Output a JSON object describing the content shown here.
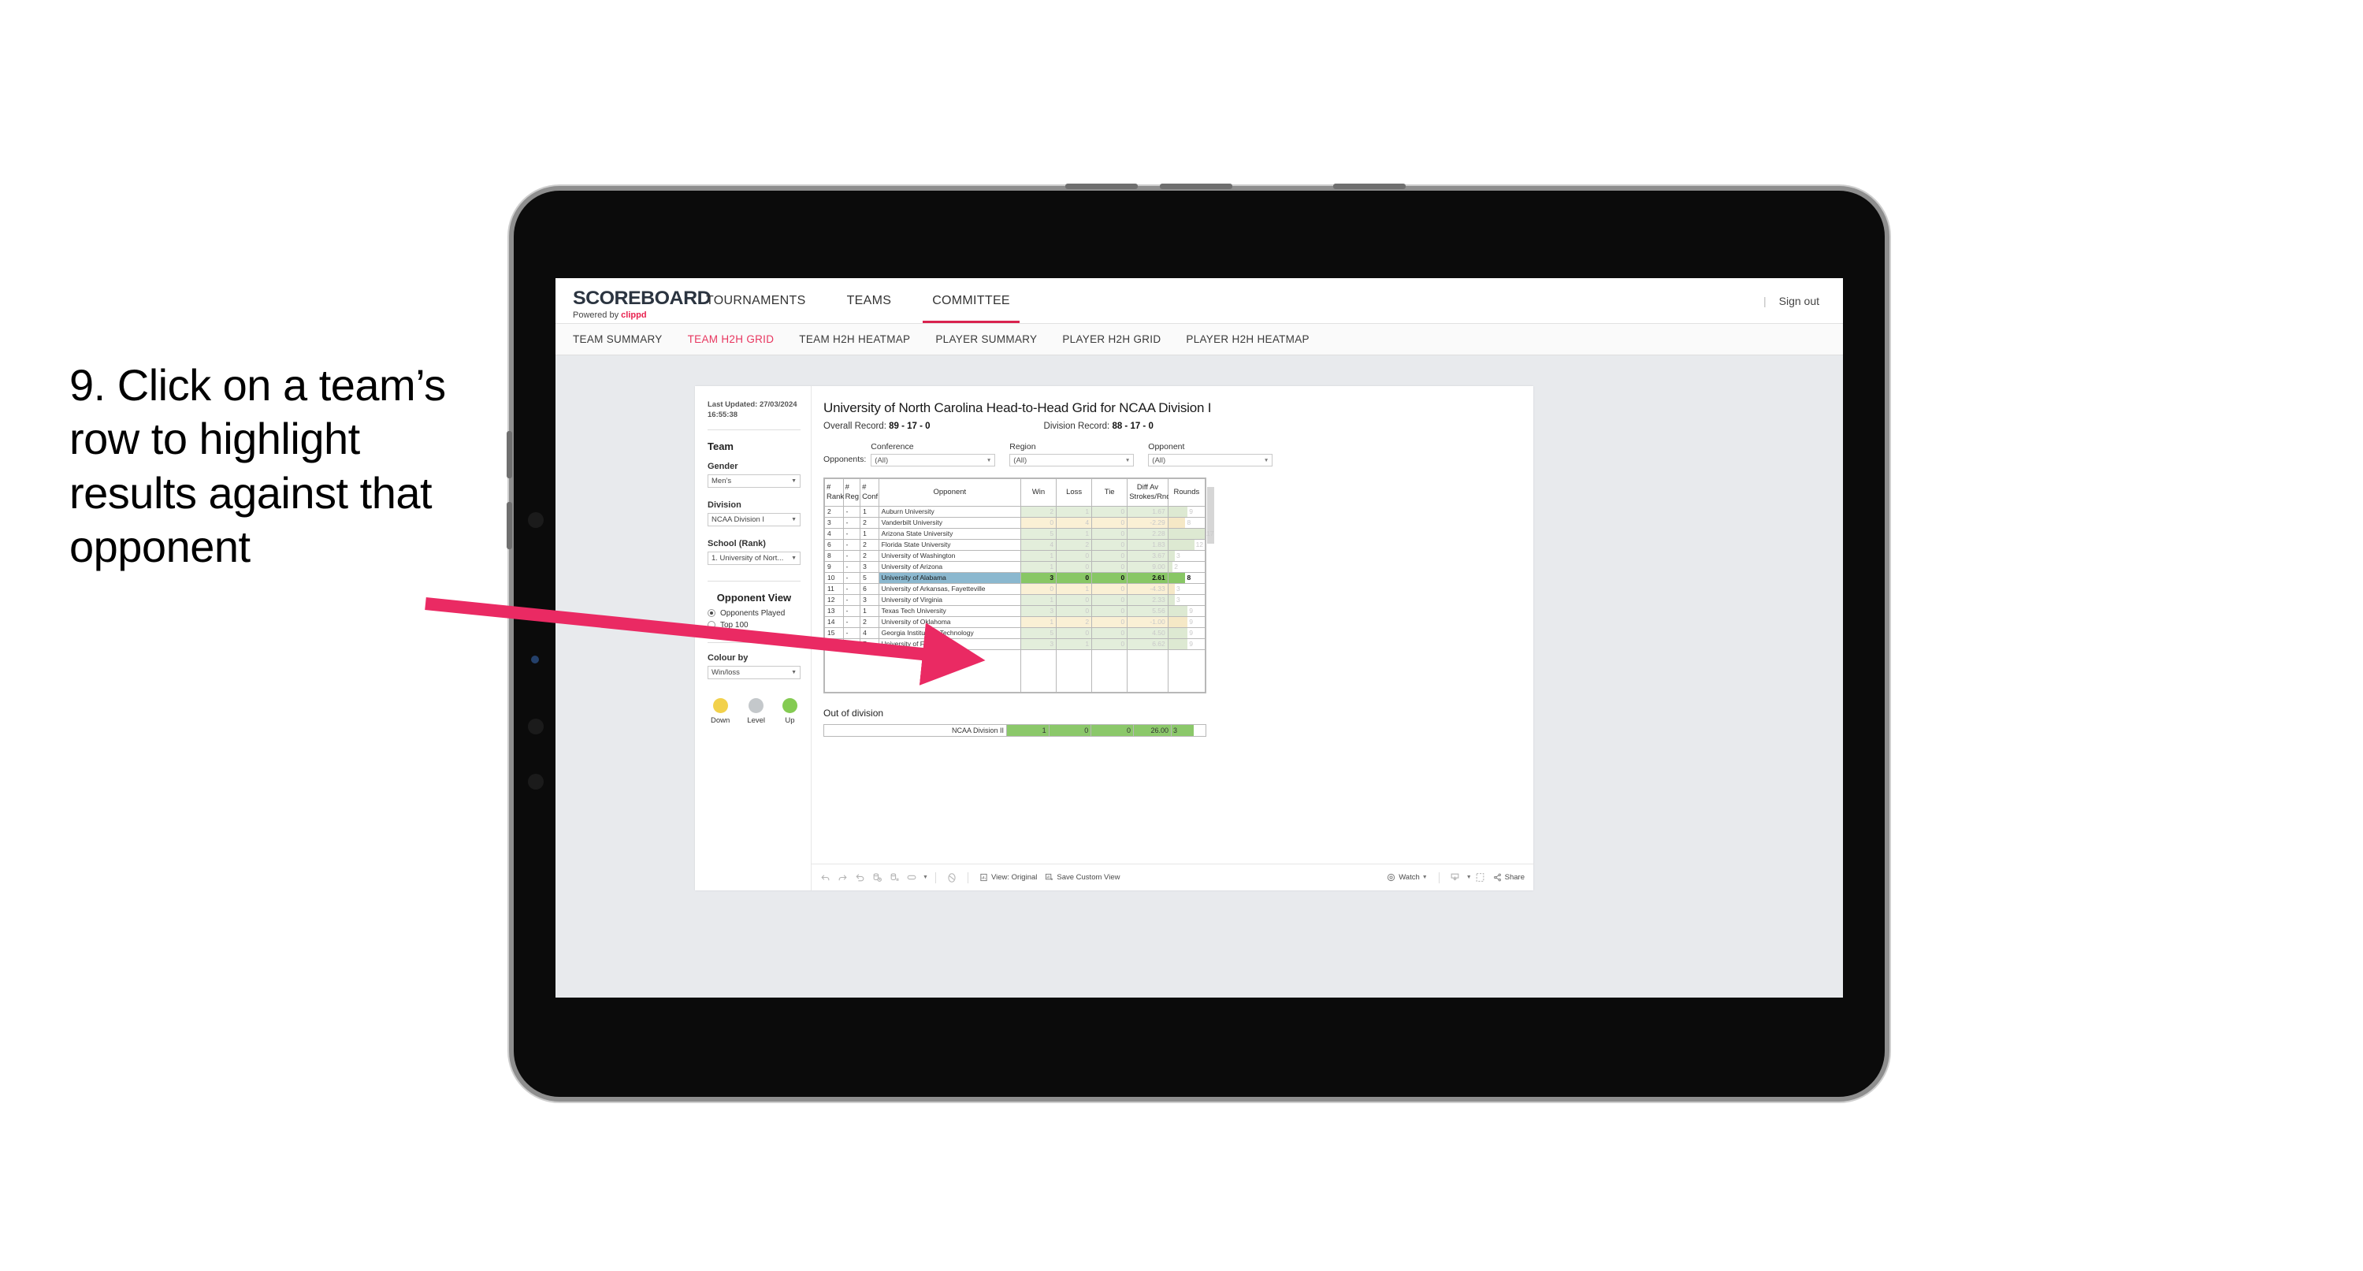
{
  "instruction": {
    "text": "9. Click on a team’s row to highlight results against that opponent"
  },
  "arrow": {
    "color": "#ea2a63"
  },
  "app": {
    "logo": {
      "main": "SCOREBOARD",
      "powered_prefix": "Powered by ",
      "brand": "clippd"
    },
    "top_nav": [
      {
        "label": "TOURNAMENTS",
        "active": false
      },
      {
        "label": "TEAMS",
        "active": false
      },
      {
        "label": "COMMITTEE",
        "active": true
      }
    ],
    "signout": {
      "divider": "|",
      "label": "Sign out"
    },
    "sub_nav": [
      {
        "label": "TEAM SUMMARY",
        "active": false
      },
      {
        "label": "TEAM H2H GRID",
        "active": true
      },
      {
        "label": "TEAM H2H HEATMAP",
        "active": false
      },
      {
        "label": "PLAYER SUMMARY",
        "active": false
      },
      {
        "label": "PLAYER H2H GRID",
        "active": false
      },
      {
        "label": "PLAYER H2H HEATMAP",
        "active": false
      }
    ]
  },
  "sidebar": {
    "last_updated": "Last Updated: 27/03/2024 16:55:38",
    "team_heading": "Team",
    "fields": [
      {
        "label": "Gender",
        "value": "Men’s"
      },
      {
        "label": "Division",
        "value": "NCAA Division I"
      },
      {
        "label": "School (Rank)",
        "value": "1. University of Nort..."
      }
    ],
    "opponent_view": {
      "heading": "Opponent View",
      "options": [
        {
          "label": "Opponents Played",
          "checked": true
        },
        {
          "label": "Top 100",
          "checked": false
        }
      ]
    },
    "colour_by": {
      "label": "Colour by",
      "value": "Win/loss"
    },
    "legend": [
      {
        "label": "Down",
        "color": "#f2d14b"
      },
      {
        "label": "Level",
        "color": "#c4c8cb"
      },
      {
        "label": "Up",
        "color": "#84cb52"
      }
    ]
  },
  "main": {
    "title": "University of North Carolina Head-to-Head Grid for NCAA Division I",
    "overall_record_label": "Overall Record: ",
    "overall_record_value": "89 - 17 - 0",
    "division_record_label": "Division Record: ",
    "division_record_value": "88 - 17 - 0",
    "opponents_label": "Opponents:",
    "filters": [
      {
        "label": "Conference",
        "value": "(All)"
      },
      {
        "label": "Region",
        "value": "(All)"
      },
      {
        "label": "Opponent",
        "value": "(All)"
      }
    ],
    "columns": [
      {
        "line1": "#",
        "line2": "Rank"
      },
      {
        "line1": "#",
        "line2": "Reg"
      },
      {
        "line1": "#",
        "line2": "Conf"
      },
      {
        "line1": "Opponent",
        "line2": ""
      },
      {
        "line1": "Win",
        "line2": ""
      },
      {
        "line1": "Loss",
        "line2": ""
      },
      {
        "line1": "Tie",
        "line2": ""
      },
      {
        "line1": "Diff Av",
        "line2": "Strokes/Rnd"
      },
      {
        "line1": "Rounds",
        "line2": ""
      }
    ],
    "rows": [
      {
        "rank": "2",
        "reg": "-",
        "conf": "1",
        "opponent": "Auburn University",
        "win": "2",
        "loss": "1",
        "tie": "0",
        "diff": "1.67",
        "rounds": "9",
        "tone": "up",
        "selected": false
      },
      {
        "rank": "3",
        "reg": "-",
        "conf": "2",
        "opponent": "Vanderbilt University",
        "win": "0",
        "loss": "4",
        "tie": "0",
        "diff": "-2.29",
        "rounds": "8",
        "tone": "down",
        "selected": false
      },
      {
        "rank": "4",
        "reg": "-",
        "conf": "1",
        "opponent": "Arizona State University",
        "win": "5",
        "loss": "1",
        "tie": "0",
        "diff": "2.28",
        "rounds": "17",
        "tone": "up",
        "selected": false
      },
      {
        "rank": "6",
        "reg": "-",
        "conf": "2",
        "opponent": "Florida State University",
        "win": "4",
        "loss": "2",
        "tie": "0",
        "diff": "1.83",
        "rounds": "12",
        "tone": "up",
        "selected": false
      },
      {
        "rank": "8",
        "reg": "-",
        "conf": "2",
        "opponent": "University of Washington",
        "win": "1",
        "loss": "0",
        "tie": "0",
        "diff": "3.67",
        "rounds": "3",
        "tone": "up",
        "selected": false
      },
      {
        "rank": "9",
        "reg": "-",
        "conf": "3",
        "opponent": "University of Arizona",
        "win": "1",
        "loss": "0",
        "tie": "0",
        "diff": "9.00",
        "rounds": "2",
        "tone": "up",
        "selected": false
      },
      {
        "rank": "10",
        "reg": "-",
        "conf": "5",
        "opponent": "University of Alabama",
        "win": "3",
        "loss": "0",
        "tie": "0",
        "diff": "2.61",
        "rounds": "8",
        "tone": "up",
        "selected": true
      },
      {
        "rank": "11",
        "reg": "-",
        "conf": "6",
        "opponent": "University of Arkansas, Fayetteville",
        "win": "0",
        "loss": "1",
        "tie": "0",
        "diff": "-4.33",
        "rounds": "3",
        "tone": "down",
        "selected": false
      },
      {
        "rank": "12",
        "reg": "-",
        "conf": "3",
        "opponent": "University of Virginia",
        "win": "1",
        "loss": "0",
        "tie": "0",
        "diff": "2.33",
        "rounds": "3",
        "tone": "up",
        "selected": false
      },
      {
        "rank": "13",
        "reg": "-",
        "conf": "1",
        "opponent": "Texas Tech University",
        "win": "3",
        "loss": "0",
        "tie": "0",
        "diff": "5.56",
        "rounds": "9",
        "tone": "up",
        "selected": false
      },
      {
        "rank": "14",
        "reg": "-",
        "conf": "2",
        "opponent": "University of Oklahoma",
        "win": "1",
        "loss": "2",
        "tie": "0",
        "diff": "-1.00",
        "rounds": "9",
        "tone": "down",
        "selected": false
      },
      {
        "rank": "15",
        "reg": "-",
        "conf": "4",
        "opponent": "Georgia Institute of Technology",
        "win": "5",
        "loss": "0",
        "tie": "0",
        "diff": "4.50",
        "rounds": "9",
        "tone": "up",
        "selected": false
      },
      {
        "rank": "16",
        "reg": "-",
        "conf": "7",
        "opponent": "University of Florida",
        "win": "3",
        "loss": "1",
        "tie": "0",
        "diff": "6.62",
        "rounds": "9",
        "tone": "up",
        "selected": false
      }
    ],
    "rounds_max": 17,
    "out_of_division": {
      "title": "Out of division",
      "label": "NCAA Division II",
      "win": "1",
      "loss": "0",
      "tie": "0",
      "diff": "26.00",
      "rounds": "3"
    }
  },
  "toolbar": {
    "view_label": "View: Original",
    "save_label": "Save Custom View",
    "watch_label": "Watch",
    "share_label": "Share"
  },
  "chart_data": {
    "type": "table",
    "title": "University of North Carolina Head-to-Head Grid for NCAA Division I",
    "columns": [
      "# Rank",
      "# Reg",
      "# Conf",
      "Opponent",
      "Win",
      "Loss",
      "Tie",
      "Diff Av Strokes/Rnd",
      "Rounds"
    ],
    "rows": [
      [
        "2",
        "-",
        "1",
        "Auburn University",
        2,
        1,
        0,
        1.67,
        9
      ],
      [
        "3",
        "-",
        "2",
        "Vanderbilt University",
        0,
        4,
        0,
        -2.29,
        8
      ],
      [
        "4",
        "-",
        "1",
        "Arizona State University",
        5,
        1,
        0,
        2.28,
        17
      ],
      [
        "6",
        "-",
        "2",
        "Florida State University",
        4,
        2,
        0,
        1.83,
        12
      ],
      [
        "8",
        "-",
        "2",
        "University of Washington",
        1,
        0,
        0,
        3.67,
        3
      ],
      [
        "9",
        "-",
        "3",
        "University of Arizona",
        1,
        0,
        0,
        9.0,
        2
      ],
      [
        "10",
        "-",
        "5",
        "University of Alabama",
        3,
        0,
        0,
        2.61,
        8
      ],
      [
        "11",
        "-",
        "6",
        "University of Arkansas, Fayetteville",
        0,
        1,
        0,
        -4.33,
        3
      ],
      [
        "12",
        "-",
        "3",
        "University of Virginia",
        1,
        0,
        0,
        2.33,
        3
      ],
      [
        "13",
        "-",
        "1",
        "Texas Tech University",
        3,
        0,
        0,
        5.56,
        9
      ],
      [
        "14",
        "-",
        "2",
        "University of Oklahoma",
        1,
        2,
        0,
        -1.0,
        9
      ],
      [
        "15",
        "-",
        "4",
        "Georgia Institute of Technology",
        5,
        0,
        0,
        4.5,
        9
      ],
      [
        "16",
        "-",
        "7",
        "University of Florida",
        3,
        1,
        0,
        6.62,
        9
      ]
    ],
    "out_of_division": [
      "NCAA Division II",
      1,
      0,
      0,
      26.0,
      3
    ],
    "overall_record": "89 - 17 - 0",
    "division_record": "88 - 17 - 0",
    "selected_row": "University of Alabama",
    "colour_by": "Win/loss",
    "legend": [
      "Down",
      "Level",
      "Up"
    ]
  }
}
